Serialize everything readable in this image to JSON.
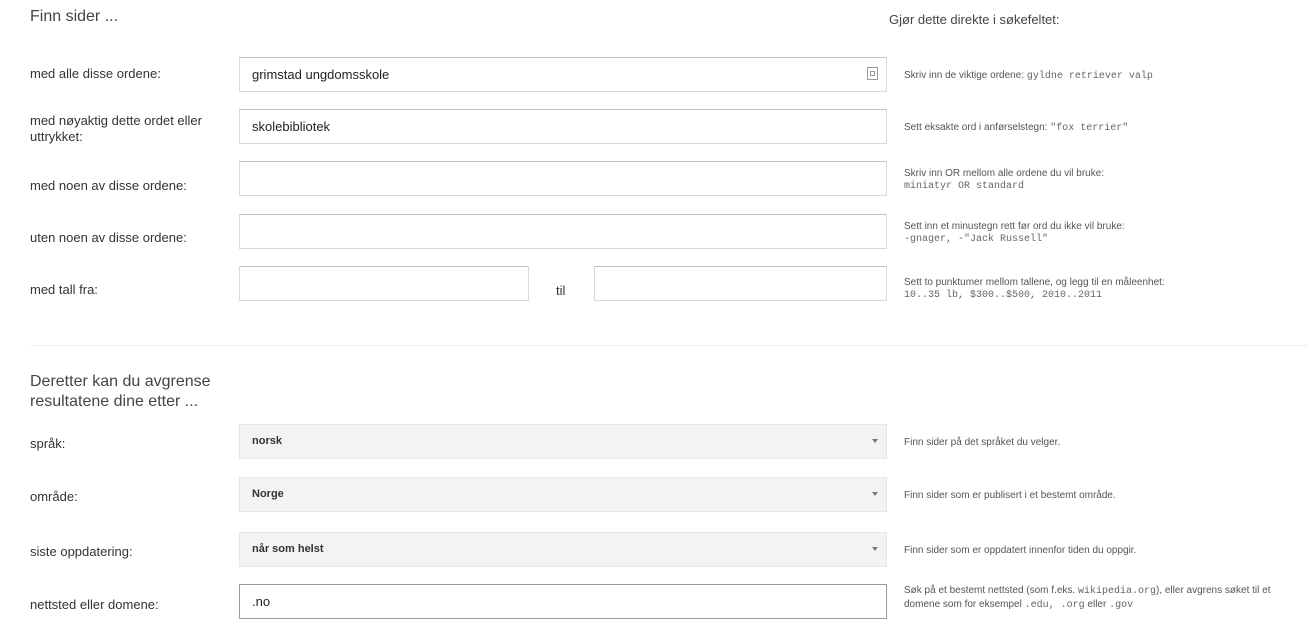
{
  "find_pages": {
    "title": "Finn sider ...",
    "hint_heading": "Gjør dette direkte i søkefeltet:",
    "rows": [
      {
        "label": "med alle disse ordene:",
        "value": "grimstad ungdomsskole",
        "hint": "Skriv inn de viktige ordene: ",
        "hint_code": "gyldne retriever valp"
      },
      {
        "label": "med nøyaktig dette ordet eller uttrykket:",
        "value": "skolebibliotek",
        "hint": "Sett eksakte ord i anførselstegn: ",
        "hint_code": "\"fox terrier\""
      },
      {
        "label": "med noen av disse ordene:",
        "value": "",
        "hint": "Skriv inn OR mellom alle ordene du vil bruke:",
        "hint_code": "miniatyr OR standard"
      },
      {
        "label": "uten noen av disse ordene:",
        "value": "",
        "hint": "Sett inn et minustegn rett før ord du ikke vil bruke:",
        "hint_code": "-gnager, -\"Jack Russell\""
      }
    ],
    "number_range": {
      "label": "med tall fra:",
      "from_value": "",
      "to_label": "til",
      "to_value": "",
      "hint": "Sett to punktumer mellom tallene, og legg til en måleenhet:",
      "hint_code": "10..35 lb, $300..$500, 2010..2011"
    }
  },
  "narrow": {
    "title": "Deretter kan du avgrense resultatene dine etter ...",
    "rows": [
      {
        "label": "språk:",
        "value": "norsk",
        "hint": "Finn sider på det språket du velger."
      },
      {
        "label": "område:",
        "value": "Norge",
        "hint": "Finn sider som er publisert i et bestemt område."
      },
      {
        "label": "siste oppdatering:",
        "value": "når som helst",
        "hint": "Finn sider som er oppdatert innenfor tiden du oppgir."
      }
    ],
    "site": {
      "label": "nettsted eller domene:",
      "value": ".no",
      "hint_a": "Søk på et bestemt nettsted (som f.eks. ",
      "hint_code_a": "wikipedia.org",
      "hint_b": "), eller avgrens søket til et domene som for eksempel ",
      "hint_code_b": ".edu, .org",
      "hint_c": " eller ",
      "hint_code_c": ".gov"
    }
  },
  "icons": {
    "keyboard": "keyboard-icon",
    "dropdown": "chevron-down-icon"
  }
}
